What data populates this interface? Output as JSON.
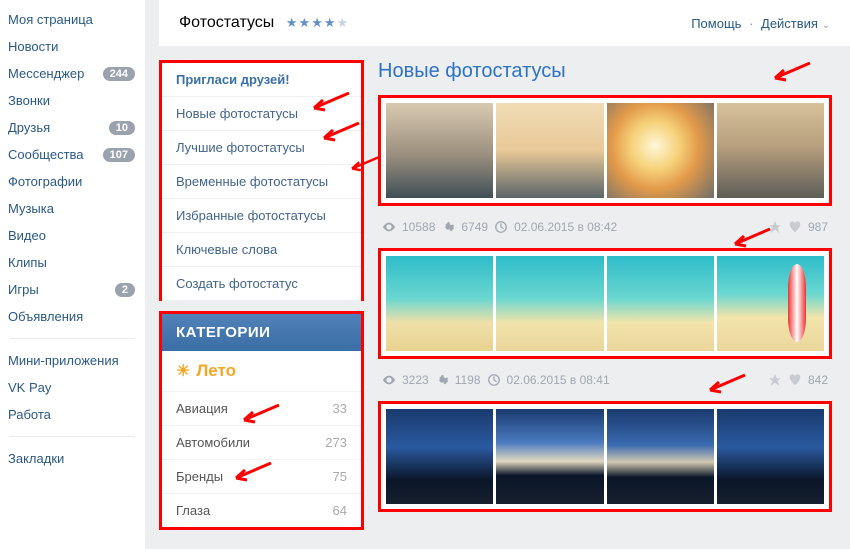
{
  "left_nav": {
    "items": [
      {
        "label": "Моя страница",
        "badge": null
      },
      {
        "label": "Новости",
        "badge": null
      },
      {
        "label": "Мессенджер",
        "badge": "244"
      },
      {
        "label": "Звонки",
        "badge": null
      },
      {
        "label": "Друзья",
        "badge": "10"
      },
      {
        "label": "Сообщества",
        "badge": "107"
      },
      {
        "label": "Фотографии",
        "badge": null
      },
      {
        "label": "Музыка",
        "badge": null
      },
      {
        "label": "Видео",
        "badge": null
      },
      {
        "label": "Клипы",
        "badge": null
      },
      {
        "label": "Игры",
        "badge": "2"
      },
      {
        "label": "Объявления",
        "badge": null
      }
    ],
    "items2": [
      {
        "label": "Мини-приложения"
      },
      {
        "label": "VK Pay"
      },
      {
        "label": "Работа"
      }
    ],
    "items3": [
      {
        "label": "Закладки"
      }
    ]
  },
  "header": {
    "title": "Фотостатусы",
    "rating_full": 4,
    "rating_total": 5,
    "help": "Помощь",
    "actions": "Действия"
  },
  "sidebar": {
    "invite": "Пригласи друзей!",
    "links": [
      "Новые фотостатусы",
      "Лучшие фотостатусы",
      "Временные фотостатусы",
      "Избранные фотостатусы",
      "Ключевые слова",
      "Создать фотостатус"
    ],
    "categories_header": "КАТЕГОРИИ",
    "featured": {
      "icon": "sun",
      "label": "Лето"
    },
    "categories": [
      {
        "name": "Авиация",
        "count": "33"
      },
      {
        "name": "Автомобили",
        "count": "273"
      },
      {
        "name": "Бренды",
        "count": "75"
      },
      {
        "name": "Глаза",
        "count": "64"
      }
    ]
  },
  "feed": {
    "title": "Новые фотостатусы",
    "items": [
      {
        "views": "10588",
        "gears": "6749",
        "date": "02.06.2015 в 08:42",
        "likes": "987",
        "theme": "sunset"
      },
      {
        "views": "3223",
        "gears": "1198",
        "date": "02.06.2015 в 08:41",
        "likes": "842",
        "theme": "beach"
      },
      {
        "views": "",
        "gears": "",
        "date": "",
        "likes": "",
        "theme": "night"
      }
    ]
  }
}
